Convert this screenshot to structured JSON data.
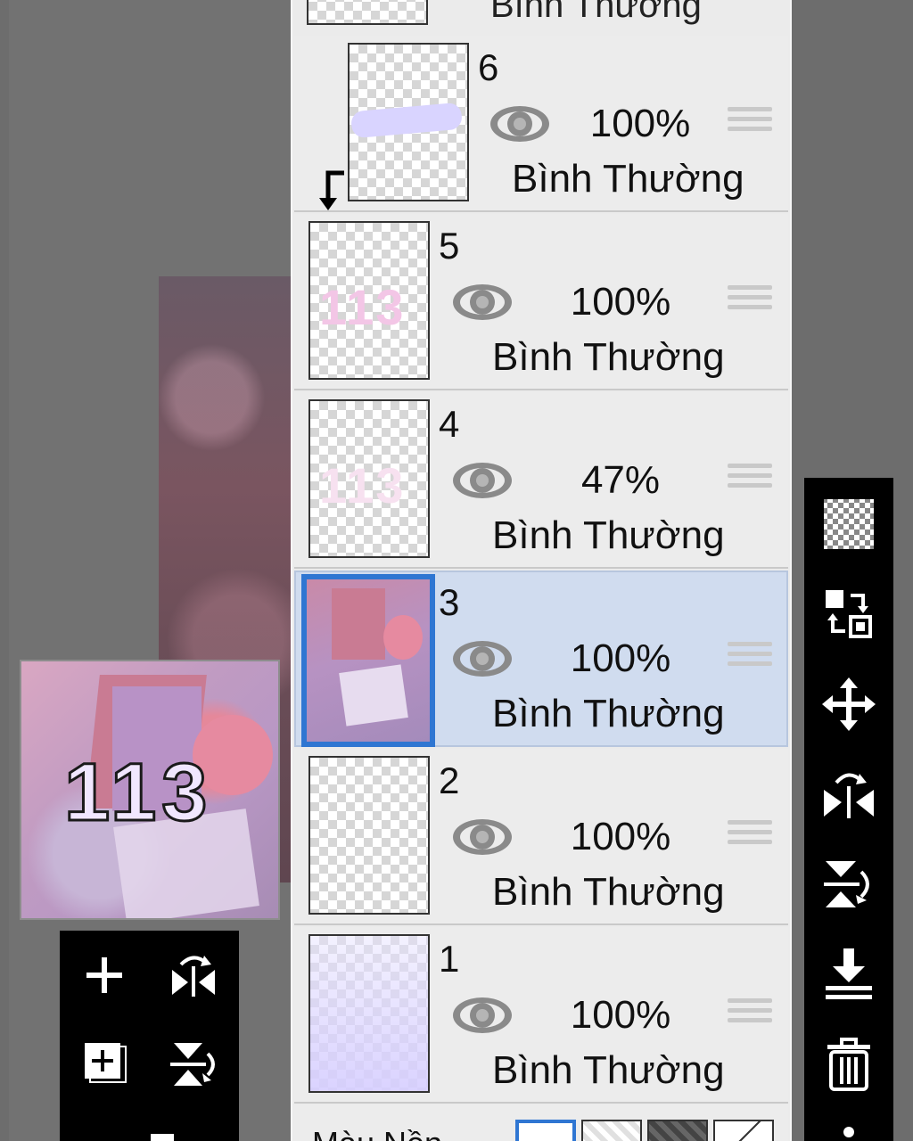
{
  "layers_panel": {
    "partial_top_blend_mode": "Bình Thường",
    "layers": [
      {
        "number": "6",
        "opacity": "100%",
        "blend_mode": "Bình Thường",
        "clipped": true,
        "selected": false
      },
      {
        "number": "5",
        "opacity": "100%",
        "blend_mode": "Bình Thường",
        "clipped": false,
        "selected": false
      },
      {
        "number": "4",
        "opacity": "47%",
        "blend_mode": "Bình Thường",
        "clipped": false,
        "selected": false
      },
      {
        "number": "3",
        "opacity": "100%",
        "blend_mode": "Bình Thường",
        "clipped": false,
        "selected": true
      },
      {
        "number": "2",
        "opacity": "100%",
        "blend_mode": "Bình Thường",
        "clipped": false,
        "selected": false
      },
      {
        "number": "1",
        "opacity": "100%",
        "blend_mode": "Bình Thường",
        "clipped": false,
        "selected": false
      }
    ],
    "bottom_label": "Màu Nền"
  },
  "navigator": {
    "preview_text": "113"
  },
  "layer_thumbnail_text": "113",
  "left_toolbar": {
    "icons": [
      "add-layer-icon",
      "flip-horizontal-icon",
      "add-layer-copy-icon",
      "flip-vertical-icon",
      "minus-icon"
    ]
  },
  "right_toolbar": {
    "icons": [
      "transparency-icon",
      "swap-layers-icon",
      "move-icon",
      "flip-horizontal-icon",
      "flip-vertical-icon",
      "merge-down-icon",
      "delete-icon",
      "more-icon"
    ]
  },
  "colors": {
    "selection": "#2f76d2",
    "selected_row": "#d0dcef",
    "panel": "#ececec"
  }
}
